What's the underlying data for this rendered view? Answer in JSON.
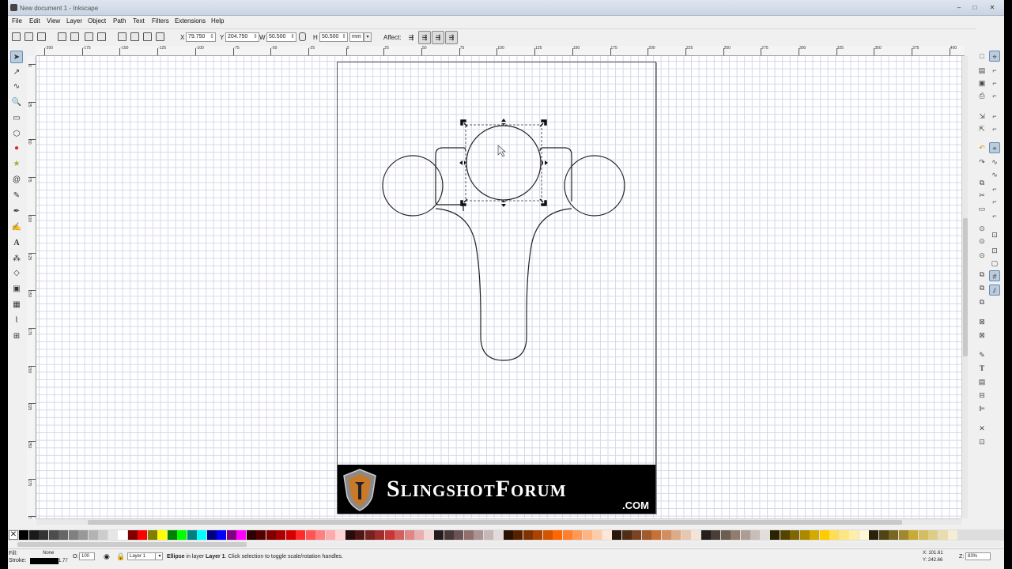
{
  "window": {
    "title": "New document 1 - Inkscape",
    "buttons": {
      "minimize": "–",
      "maximize": "□",
      "close": "✕"
    }
  },
  "menu": [
    "File",
    "Edit",
    "View",
    "Layer",
    "Object",
    "Path",
    "Text",
    "Filters",
    "Extensions",
    "Help"
  ],
  "controls": {
    "x_label": "X",
    "x_value": "79.750",
    "y_label": "Y",
    "y_value": "204.750",
    "w_label": "W",
    "w_value": "50.500",
    "h_label": "H",
    "h_value": "50.500",
    "unit": "mm",
    "affect_label": "Affect:"
  },
  "ruler": {
    "h_labels": [
      "-200",
      "-175",
      "-150",
      "-125",
      "-100",
      "-75",
      "-50",
      "-25",
      "0",
      "25",
      "50",
      "75",
      "100",
      "125",
      "150",
      "175",
      "200",
      "225",
      "250",
      "275",
      "300",
      "325",
      "350",
      "375",
      "400"
    ],
    "v_labels": [
      "0",
      "25",
      "50",
      "75",
      "100",
      "125",
      "150",
      "175",
      "200",
      "225",
      "250",
      "275",
      "300",
      "325"
    ]
  },
  "banner": {
    "brand": "SlingshotForum",
    "domain": ".COM"
  },
  "status": {
    "fill_label": "Fill:",
    "fill_value": "None",
    "stroke_label": "Stroke:",
    "stroke_width": "1.77",
    "opacity_label": "O:",
    "opacity_value": "100",
    "layer": "Layer 1",
    "message_bold": "Ellipse",
    "message_mid": " in layer ",
    "message_layer": "Layer 1",
    "message_rest": ". Click selection to toggle scale/rotation handles.",
    "x_coord": "X: 101.61",
    "y_coord": "Y: 242.66",
    "zoom_label": "Z:",
    "zoom_value": "83%"
  },
  "palette_colors": [
    "#000000",
    "#1a1a1a",
    "#333333",
    "#4d4d4d",
    "#666666",
    "#808080",
    "#999999",
    "#b3b3b3",
    "#cccccc",
    "#e6e6e6",
    "#ffffff",
    "#800000",
    "#ff0000",
    "#808000",
    "#ffff00",
    "#008000",
    "#00ff00",
    "#008080",
    "#00ffff",
    "#000080",
    "#0000ff",
    "#800080",
    "#ff00ff",
    "#2b0000",
    "#550000",
    "#800000",
    "#aa0000",
    "#d40000",
    "#ff2a2a",
    "#ff5555",
    "#ff8080",
    "#ffaaaa",
    "#ffd5d5",
    "#280b0b",
    "#501616",
    "#782121",
    "#a02c2c",
    "#c83737",
    "#d35f5f",
    "#de8787",
    "#e9afaf",
    "#f4d7d7",
    "#241c1c",
    "#483737",
    "#6c5353",
    "#916f6f",
    "#ac9393",
    "#c8b7b7",
    "#e3dbdb",
    "#2b1100",
    "#552200",
    "#803300",
    "#aa4400",
    "#d45500",
    "#ff6600",
    "#ff7f2a",
    "#ff9955",
    "#ffb380",
    "#ffccaa",
    "#ffe6d5",
    "#28170b",
    "#502d16",
    "#784421",
    "#a05a2c",
    "#c87137",
    "#d38d5f",
    "#deaa87",
    "#e9c6af",
    "#f4e3d7",
    "#241f1c",
    "#483e37",
    "#6c5d53",
    "#917c6f",
    "#ac9d93",
    "#c8beb7",
    "#e3dedb",
    "#2b2200",
    "#554400",
    "#806600",
    "#aa8800",
    "#d4aa00",
    "#ffcc00",
    "#ffdd55",
    "#ffe680",
    "#ffeeaa",
    "#fff6d5",
    "#28220b",
    "#504416",
    "#786721",
    "#a0892c",
    "#c8ab37",
    "#d4bd5f",
    "#decd87",
    "#e9ddaf",
    "#f4eed7"
  ]
}
